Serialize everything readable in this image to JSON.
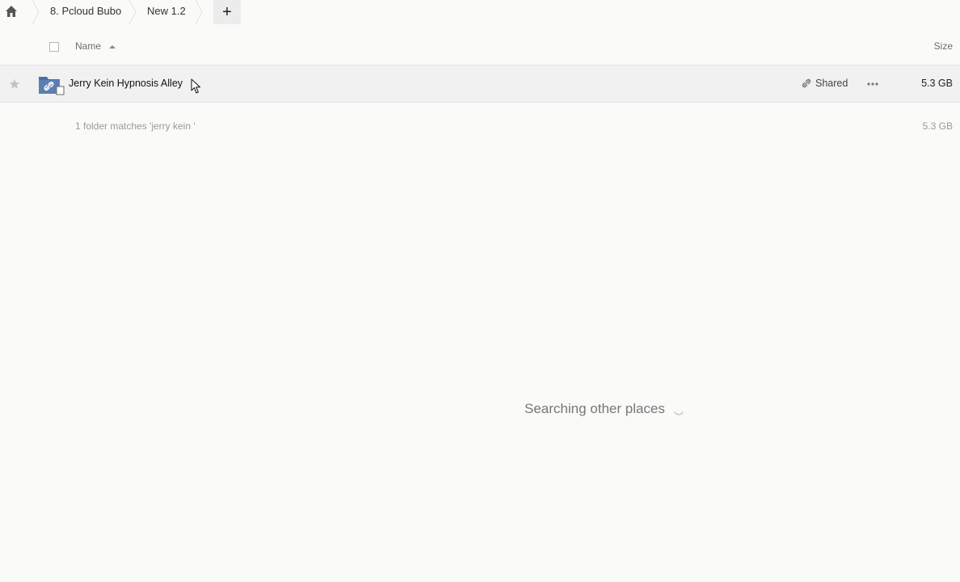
{
  "breadcrumb": {
    "items": [
      {
        "label": "8. Pcloud Bubo"
      },
      {
        "label": "New 1.2"
      }
    ],
    "add_label": "+"
  },
  "header": {
    "name_label": "Name",
    "size_label": "Size"
  },
  "files": [
    {
      "name": "Jerry Kein Hypnosis Alley",
      "shared_label": "Shared",
      "size": "5.3 GB"
    }
  ],
  "summary": {
    "text": "1 folder matches 'jerry kein '",
    "size": "5.3 GB"
  },
  "search_status": "Searching other places",
  "colors": {
    "folder_blue": "#4a6fa5",
    "row_highlight": "#f1f1f1",
    "add_button_bg": "#ececec"
  }
}
